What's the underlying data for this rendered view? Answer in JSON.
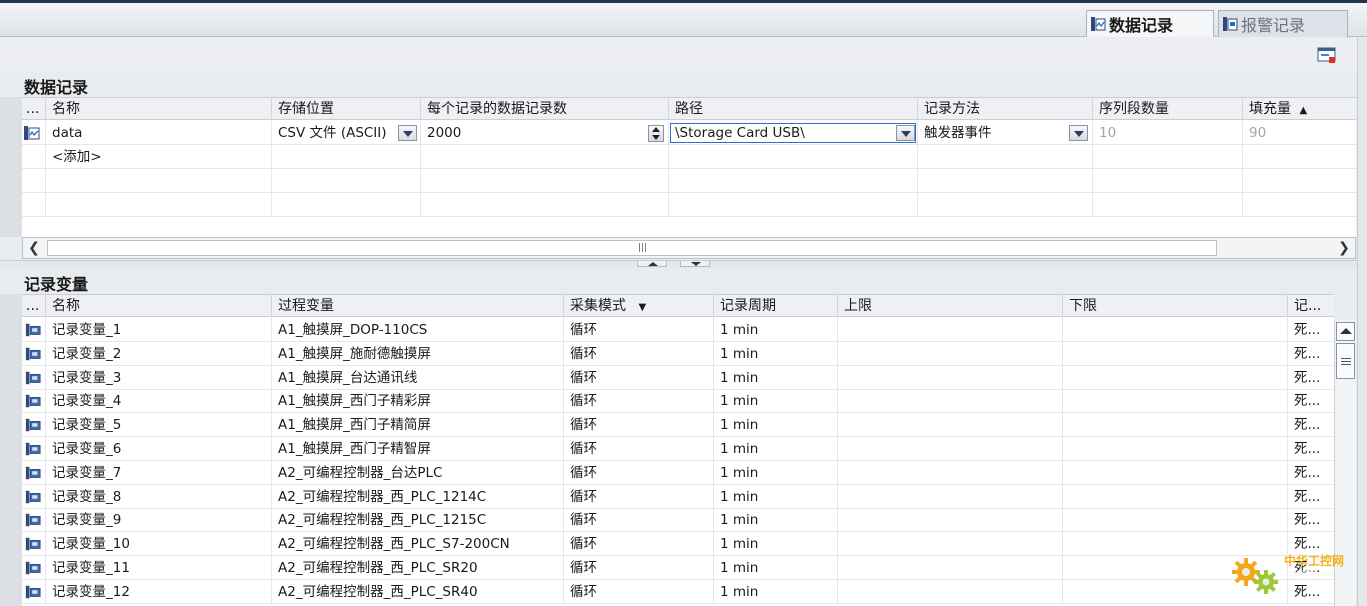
{
  "tabs": [
    {
      "label": "数据记录",
      "active": true,
      "icon": "data-log-icon"
    },
    {
      "label": "报警记录",
      "active": false,
      "icon": "alarm-log-icon"
    }
  ],
  "toolbar": {
    "icon": "screen-edit-icon"
  },
  "data_log": {
    "title": "数据记录",
    "columns": [
      "...",
      "名称",
      "存储位置",
      "每个记录的数据记录数",
      "路径",
      "记录方法",
      "序列段数量",
      "填充量"
    ],
    "sort_indicator": "▲",
    "rows": [
      {
        "name": "data",
        "storage": "CSV 文件 (ASCII)",
        "records": "2000",
        "path": "\\Storage Card USB\\",
        "method": "触发器事件",
        "segments": "10",
        "fill": "90"
      }
    ],
    "add_label": "<添加>",
    "scroll_grip": "|||"
  },
  "log_tags": {
    "title": "记录变量",
    "columns": [
      "...",
      "名称",
      "过程变量",
      "采集模式",
      "记录周期",
      "上限",
      "下限",
      "记..."
    ],
    "sort_indicator": "▼",
    "rows": [
      {
        "name": "记录变量_1",
        "process": "A1_触摸屏_DOP-110CS",
        "mode": "循环",
        "cycle": "1 min",
        "upper": "",
        "lower": "",
        "rec": "死..."
      },
      {
        "name": "记录变量_2",
        "process": "A1_触摸屏_施耐德触摸屏",
        "mode": "循环",
        "cycle": "1 min",
        "upper": "",
        "lower": "",
        "rec": "死..."
      },
      {
        "name": "记录变量_3",
        "process": "A1_触摸屏_台达通讯线",
        "mode": "循环",
        "cycle": "1 min",
        "upper": "",
        "lower": "",
        "rec": "死..."
      },
      {
        "name": "记录变量_4",
        "process": "A1_触摸屏_西门子精彩屏",
        "mode": "循环",
        "cycle": "1 min",
        "upper": "",
        "lower": "",
        "rec": "死..."
      },
      {
        "name": "记录变量_5",
        "process": "A1_触摸屏_西门子精简屏",
        "mode": "循环",
        "cycle": "1 min",
        "upper": "",
        "lower": "",
        "rec": "死..."
      },
      {
        "name": "记录变量_6",
        "process": "A1_触摸屏_西门子精智屏",
        "mode": "循环",
        "cycle": "1 min",
        "upper": "",
        "lower": "",
        "rec": "死..."
      },
      {
        "name": "记录变量_7",
        "process": "A2_可编程控制器_台达PLC",
        "mode": "循环",
        "cycle": "1 min",
        "upper": "",
        "lower": "",
        "rec": "死..."
      },
      {
        "name": "记录变量_8",
        "process": "A2_可编程控制器_西_PLC_1214C",
        "mode": "循环",
        "cycle": "1 min",
        "upper": "",
        "lower": "",
        "rec": "死..."
      },
      {
        "name": "记录变量_9",
        "process": "A2_可编程控制器_西_PLC_1215C",
        "mode": "循环",
        "cycle": "1 min",
        "upper": "",
        "lower": "",
        "rec": "死..."
      },
      {
        "name": "记录变量_10",
        "process": "A2_可编程控制器_西_PLC_S7-200CN",
        "mode": "循环",
        "cycle": "1 min",
        "upper": "",
        "lower": "",
        "rec": "死..."
      },
      {
        "name": "记录变量_11",
        "process": "A2_可编程控制器_西_PLC_SR20",
        "mode": "循环",
        "cycle": "1 min",
        "upper": "",
        "lower": "",
        "rec": "死..."
      },
      {
        "name": "记录变量_12",
        "process": "A2_可编程控制器_西_PLC_SR40",
        "mode": "循环",
        "cycle": "1 min",
        "upper": "",
        "lower": "",
        "rec": "死..."
      }
    ]
  },
  "watermark": {
    "title": "中华工控网",
    "sub": "gkong.com"
  }
}
